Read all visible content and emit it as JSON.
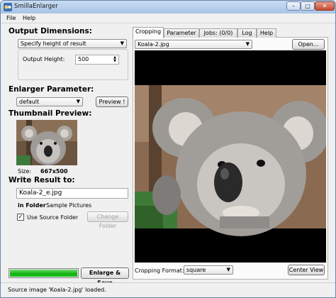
{
  "window": {
    "title": "SmillaEnlarger"
  },
  "menu": {
    "file": "File",
    "help": "Help"
  },
  "output_dimensions": {
    "heading": "Output Dimensions:",
    "mode": "Specify height of result",
    "height_label": "Output Height:",
    "height_value": "500"
  },
  "enlarger": {
    "heading": "Enlarger Parameter:",
    "preset": "default",
    "preview_button": "Preview !"
  },
  "thumbnail": {
    "heading": "Thumbnail Preview:",
    "size_label": "Size:",
    "size_value": "667x500"
  },
  "write": {
    "heading": "Write Result to:",
    "filename": "Koala-2_e.jpg",
    "in_folder_label": "in Folder",
    "folder_value": "Sample Pictures",
    "use_source_folder_label": "Use Source Folder",
    "use_source_folder_checked": true,
    "change_folder_button": "Change Folder"
  },
  "progress": {
    "fraction": 1.0
  },
  "enlarge_button": "Enlarge & Save",
  "tabs": [
    "Cropping",
    "Parameter",
    "Jobs: (0/0)",
    "Log",
    "Help"
  ],
  "active_tab": 0,
  "source": {
    "file": "Koala-2.jpg",
    "open_button": "Open..."
  },
  "cropping": {
    "format_label": "Cropping Format:",
    "format_value": "square",
    "center_view_button": "Center View"
  },
  "status": "Source image 'Koala-2.jpg' loaded.",
  "icons": {
    "app": "app-icon",
    "minimize": "minimize-icon",
    "maximize": "maximize-icon",
    "close": "close-icon",
    "dropdown": "chevron-down-icon"
  },
  "colors": {
    "progress": "#18b818",
    "titlebar": "#b8cfec",
    "window_bg": "#f0f0f0"
  }
}
